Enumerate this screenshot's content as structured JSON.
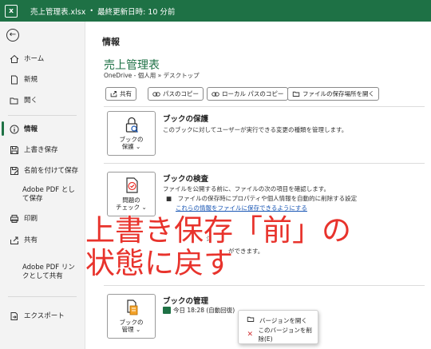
{
  "titlebar": {
    "filename": "売上管理表.xlsx",
    "separator": "•",
    "saved": "最終更新日時: 10 分前"
  },
  "sidebar": {
    "items": [
      {
        "label": "ホーム",
        "icon": "home-icon"
      },
      {
        "label": "新規",
        "icon": "new-file-icon"
      },
      {
        "label": "開く",
        "icon": "open-folder-icon"
      },
      {
        "label": "情報",
        "icon": "info-icon"
      },
      {
        "label": "上書き保存",
        "icon": "save-icon"
      },
      {
        "label": "名前を付けて保存",
        "icon": "save-as-icon"
      },
      {
        "label": "Adobe PDF として保存",
        "icon": ""
      },
      {
        "label": "印刷",
        "icon": "print-icon"
      },
      {
        "label": "共有",
        "icon": "share-icon"
      },
      {
        "label": "Adobe PDF リンクとして共有",
        "icon": ""
      },
      {
        "label": "エクスポート",
        "icon": "export-icon"
      }
    ]
  },
  "main": {
    "title": "情報",
    "workbook_name": "売上管理表",
    "path": "OneDrive - 個人用 » デスクトップ",
    "buttons": [
      {
        "label": "共有",
        "icon": "share-icon"
      },
      {
        "label": "パスのコピー",
        "icon": "link-icon"
      },
      {
        "label": "ローカル パスのコピー",
        "icon": "link-icon"
      },
      {
        "label": "ファイルの保存場所を開く",
        "icon": "folder-icon"
      }
    ],
    "protect": {
      "button": "ブックの保護 ⌄",
      "button_l1": "ブックの",
      "button_l2": "保護 ⌄",
      "title": "ブックの保護",
      "desc": "このブックに対してユーザーが実行できる変更の種類を管理します。"
    },
    "inspect": {
      "button_l1": "問題の",
      "button_l2": "チェック ⌄",
      "title": "ブックの検査",
      "desc": "ファイルを公開する前に、ファイルの次の項目を確認します。",
      "bullet": "■　ファイルの保存時にプロパティや個人情報を自動的に削除する設定",
      "link": "これらの情報をファイルに保存できるようにする"
    },
    "partial_text": "ジ",
    "partial_text2": "ができます。",
    "manage": {
      "button_l1": "ブックの",
      "button_l2": "管理 ⌄",
      "title": "ブックの管理",
      "version": "今日 18:28 (自動回復)"
    },
    "context_menu": [
      {
        "label": "バージョンを開く",
        "icon": "open-folder-icon"
      },
      {
        "label": "このバージョンを削除(E)",
        "icon": "delete-x-icon"
      }
    ]
  },
  "overlay": {
    "line1": "上書き保存「前」の",
    "line2": "状態に戻す",
    "color": "#e8332c"
  },
  "colors": {
    "accent": "#1e7145",
    "link": "#1a57b5"
  }
}
